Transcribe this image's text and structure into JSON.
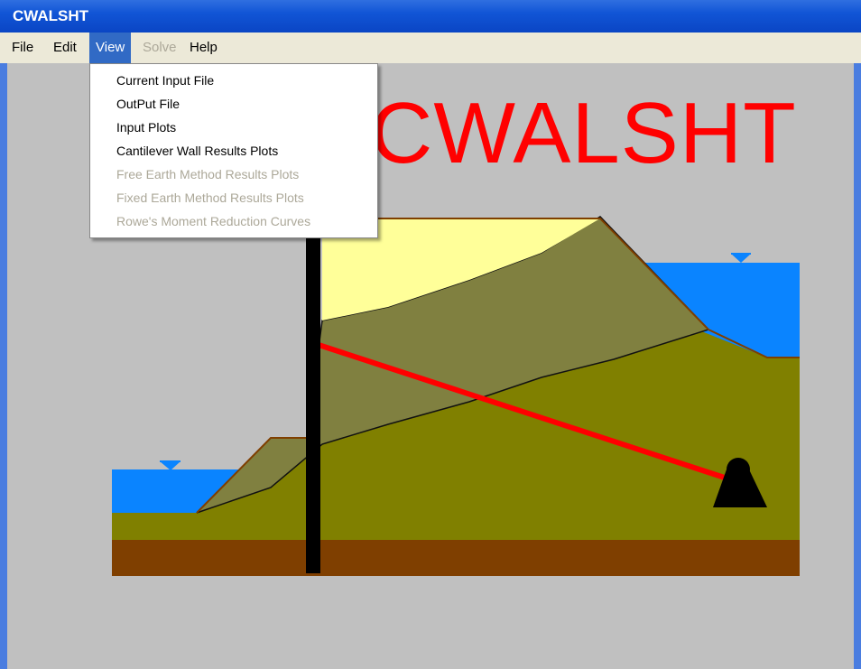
{
  "window": {
    "title": "CWALSHT"
  },
  "menubar": {
    "items": [
      {
        "label": "File",
        "state": "normal"
      },
      {
        "label": "Edit",
        "state": "normal"
      },
      {
        "label": "View",
        "state": "active"
      },
      {
        "label": "Solve",
        "state": "disabled"
      },
      {
        "label": "Help",
        "state": "normal"
      }
    ]
  },
  "view_menu": {
    "items": [
      {
        "label": "Current Input File",
        "enabled": true
      },
      {
        "label": "OutPut File",
        "enabled": true
      },
      {
        "label": "Input Plots",
        "enabled": true
      },
      {
        "label": "Cantilever Wall Results Plots",
        "enabled": true
      },
      {
        "label": "Free Earth Method Results Plots",
        "enabled": false
      },
      {
        "label": "Fixed Earth Method Results Plots",
        "enabled": false
      },
      {
        "label": "Rowe's Moment Reduction Curves",
        "enabled": false
      }
    ]
  },
  "splash": {
    "title": "CWALSHT"
  },
  "colors": {
    "accent": "#316ac5",
    "splash_title": "#ff0000",
    "water": "#0a84ff",
    "soil_top": "#ffff99",
    "soil_mid": "#808040",
    "soil_base": "#808000",
    "bedrock": "#7f3f00",
    "wall": "#000000",
    "anchor_rod": "#ff0000"
  }
}
